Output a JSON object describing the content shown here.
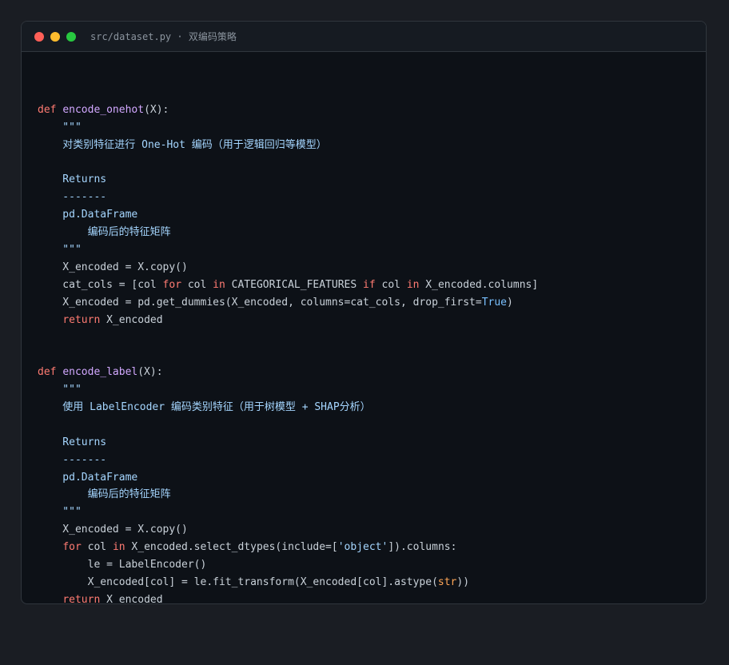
{
  "window": {
    "title": "src/dataset.py · 双编码策略"
  },
  "colors": {
    "background": "#1a1d23",
    "editor": "#0d1117",
    "keyword": "#ff7b72",
    "function": "#d2a8ff",
    "docstring": "#a5d6ff",
    "builtin": "#ffa657",
    "constant": "#79c0ff",
    "text": "#c9d1d9"
  },
  "code": {
    "lines": [
      [],
      [
        {
          "t": "def",
          "c": "kw"
        },
        {
          "t": " "
        },
        {
          "t": "encode_onehot",
          "c": "fn"
        },
        {
          "t": "(X):"
        }
      ],
      [
        {
          "t": "    \"\"\"",
          "c": "doc"
        }
      ],
      [
        {
          "t": "    对类别特征进行 One-Hot 编码（用于逻辑回归等模型）",
          "c": "doc"
        }
      ],
      [],
      [
        {
          "t": "    Returns",
          "c": "doc"
        }
      ],
      [
        {
          "t": "    -------",
          "c": "doc"
        }
      ],
      [
        {
          "t": "    pd.DataFrame",
          "c": "doc"
        }
      ],
      [
        {
          "t": "        编码后的特征矩阵",
          "c": "doc"
        }
      ],
      [
        {
          "t": "    \"\"\"",
          "c": "doc"
        }
      ],
      [
        {
          "t": "    X_encoded = X.copy()"
        }
      ],
      [
        {
          "t": "    cat_cols = [col "
        },
        {
          "t": "for",
          "c": "kw"
        },
        {
          "t": " col "
        },
        {
          "t": "in",
          "c": "kw"
        },
        {
          "t": " CATEGORICAL_FEATURES "
        },
        {
          "t": "if",
          "c": "kw"
        },
        {
          "t": " col "
        },
        {
          "t": "in",
          "c": "kw"
        },
        {
          "t": " X_encoded.columns]"
        }
      ],
      [
        {
          "t": "    X_encoded = pd.get_dummies(X_encoded, columns=cat_cols, drop_first="
        },
        {
          "t": "True",
          "c": "const"
        },
        {
          "t": ")"
        }
      ],
      [
        {
          "t": "    "
        },
        {
          "t": "return",
          "c": "kw"
        },
        {
          "t": " X_encoded"
        }
      ],
      [],
      [],
      [
        {
          "t": "def",
          "c": "kw"
        },
        {
          "t": " "
        },
        {
          "t": "encode_label",
          "c": "fn"
        },
        {
          "t": "(X):"
        }
      ],
      [
        {
          "t": "    \"\"\"",
          "c": "doc"
        }
      ],
      [
        {
          "t": "    使用 LabelEncoder 编码类别特征（用于树模型 + SHAP分析）",
          "c": "doc"
        }
      ],
      [],
      [
        {
          "t": "    Returns",
          "c": "doc"
        }
      ],
      [
        {
          "t": "    -------",
          "c": "doc"
        }
      ],
      [
        {
          "t": "    pd.DataFrame",
          "c": "doc"
        }
      ],
      [
        {
          "t": "        编码后的特征矩阵",
          "c": "doc"
        }
      ],
      [
        {
          "t": "    \"\"\"",
          "c": "doc"
        }
      ],
      [
        {
          "t": "    X_encoded = X.copy()"
        }
      ],
      [
        {
          "t": "    "
        },
        {
          "t": "for",
          "c": "kw"
        },
        {
          "t": " col "
        },
        {
          "t": "in",
          "c": "kw"
        },
        {
          "t": " X_encoded.select_dtypes(include=["
        },
        {
          "t": "'object'",
          "c": "str"
        },
        {
          "t": "]).columns:"
        }
      ],
      [
        {
          "t": "        le = LabelEncoder()"
        }
      ],
      [
        {
          "t": "        X_encoded[col] = le.fit_transform(X_encoded[col].astype("
        },
        {
          "t": "str",
          "c": "builtin"
        },
        {
          "t": "))"
        }
      ],
      [
        {
          "t": "    "
        },
        {
          "t": "return",
          "c": "kw"
        },
        {
          "t": " X_encoded"
        }
      ]
    ]
  }
}
